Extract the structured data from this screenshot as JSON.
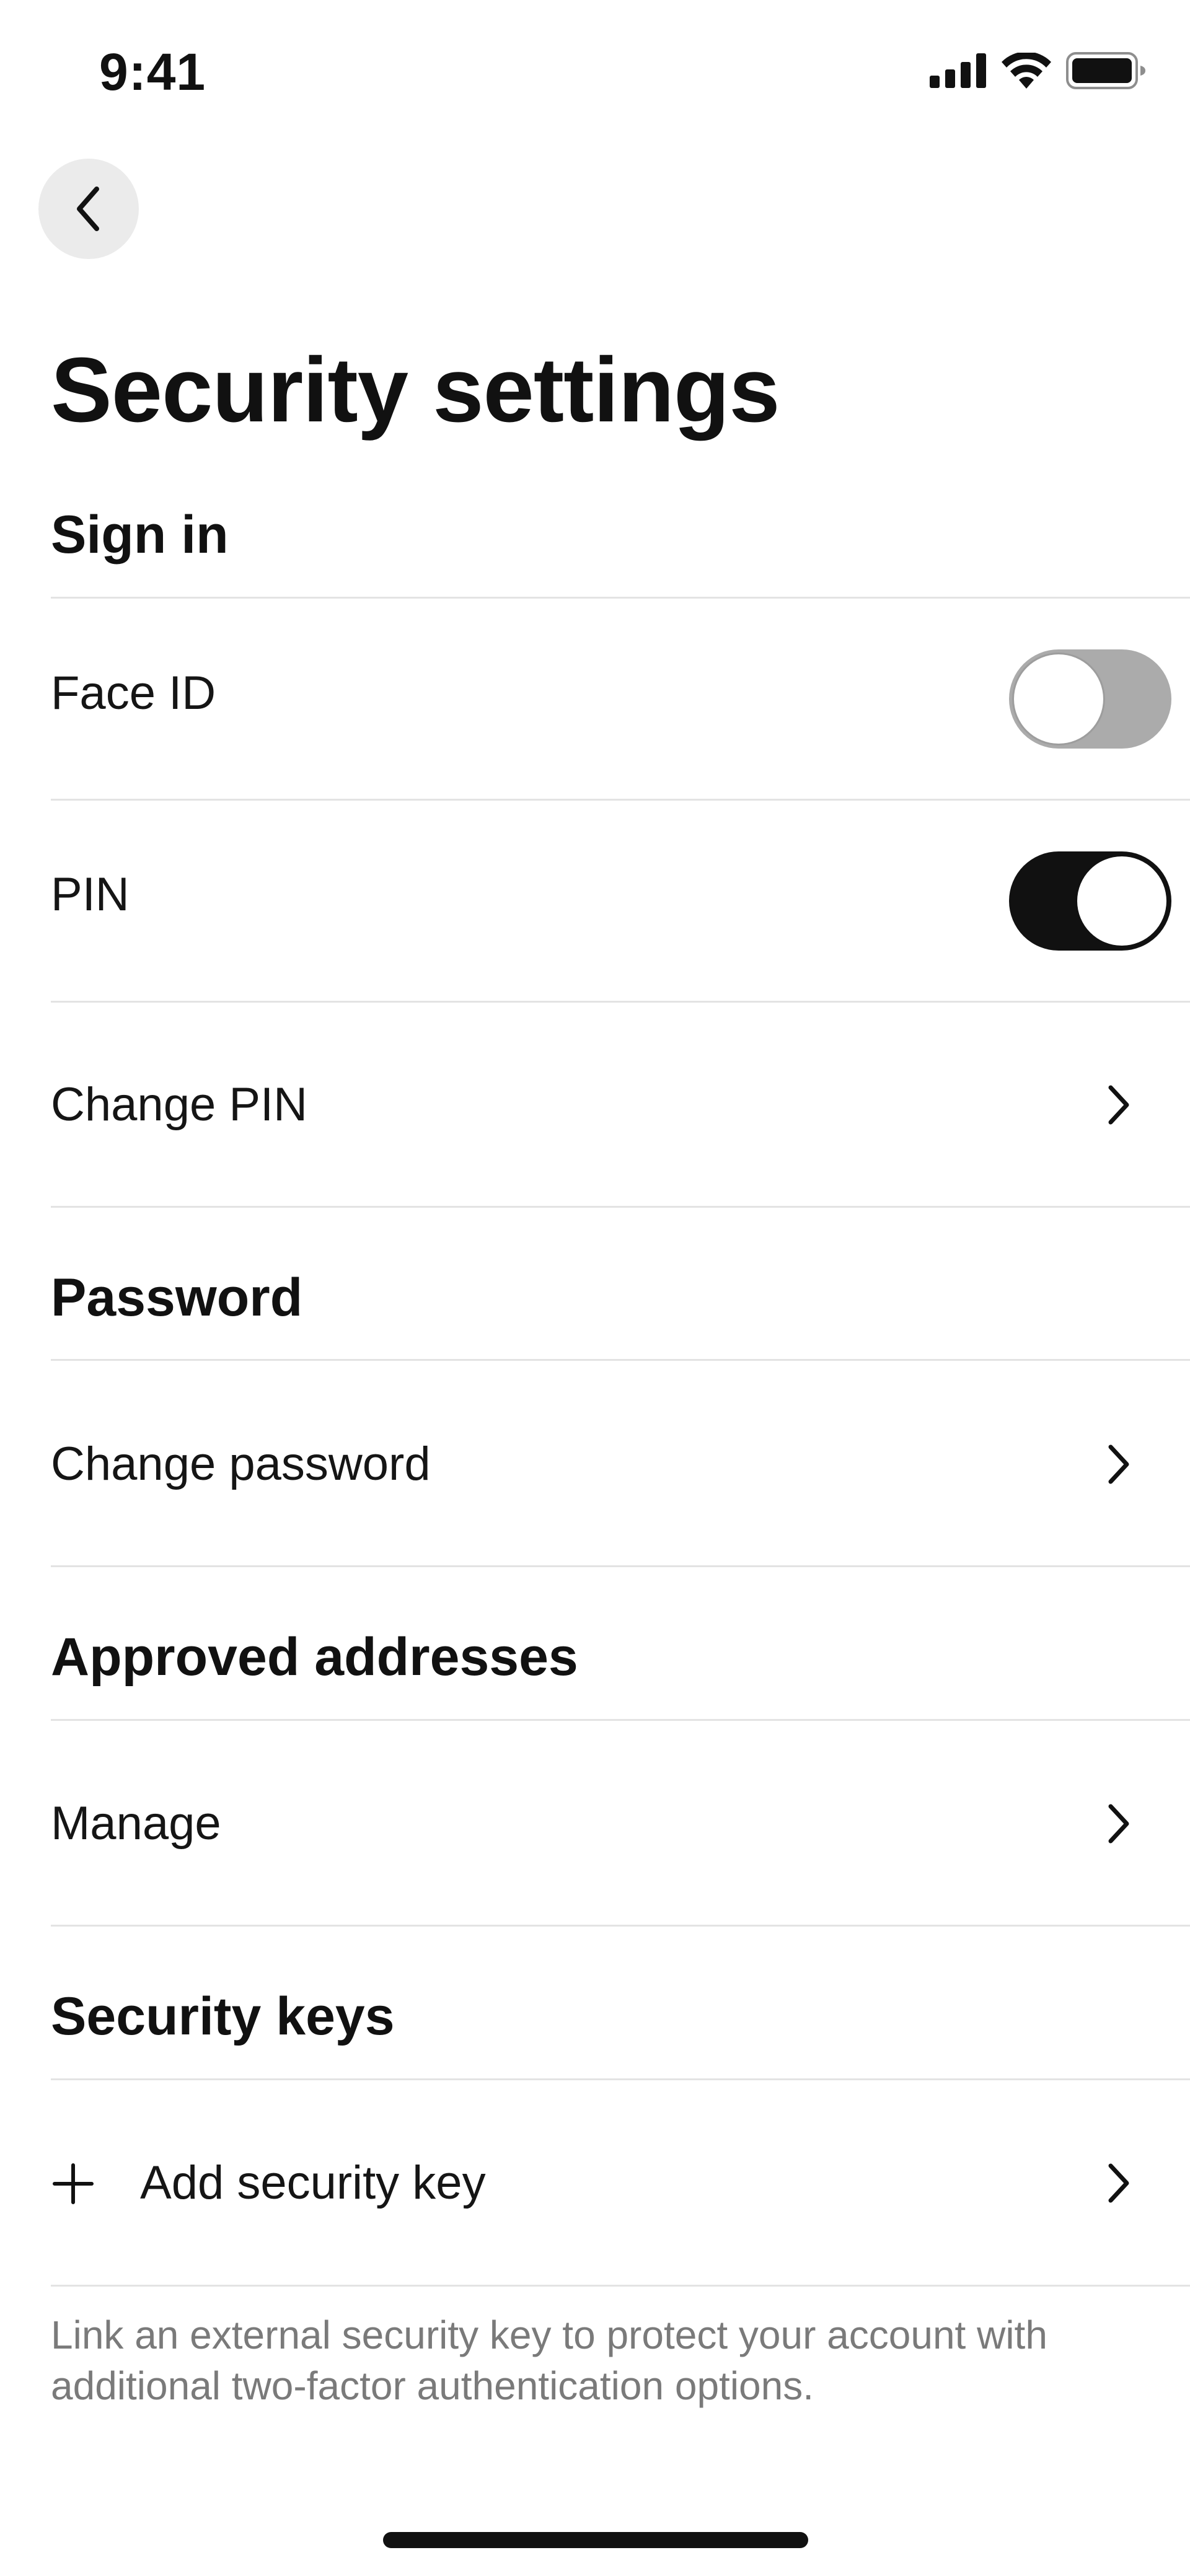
{
  "status_bar": {
    "time": "9:41",
    "icons": [
      "cellular-signal-icon",
      "wifi-icon",
      "battery-icon"
    ]
  },
  "header": {
    "back_icon": "chevron-left-icon",
    "title": "Security settings"
  },
  "sections": {
    "sign_in": {
      "title": "Sign in",
      "face_id": {
        "label": "Face ID",
        "enabled": false
      },
      "pin": {
        "label": "PIN",
        "enabled": true
      },
      "change_pin": {
        "label": "Change PIN"
      }
    },
    "password": {
      "title": "Password",
      "change_password": {
        "label": "Change password"
      }
    },
    "approved_addresses": {
      "title": "Approved addresses",
      "manage": {
        "label": "Manage"
      }
    },
    "security_keys": {
      "title": "Security keys",
      "add_key": {
        "label": "Add security key",
        "icon": "plus-icon"
      },
      "footnote": "Link an external security key to protect your account with additional two-factor authentication options."
    }
  },
  "colors": {
    "toggle_on": "#111111",
    "toggle_off": "#ababab",
    "divider": "#e3e3e3",
    "back_button_bg": "#ebebeb",
    "footnote_text": "#7a7a7a"
  }
}
